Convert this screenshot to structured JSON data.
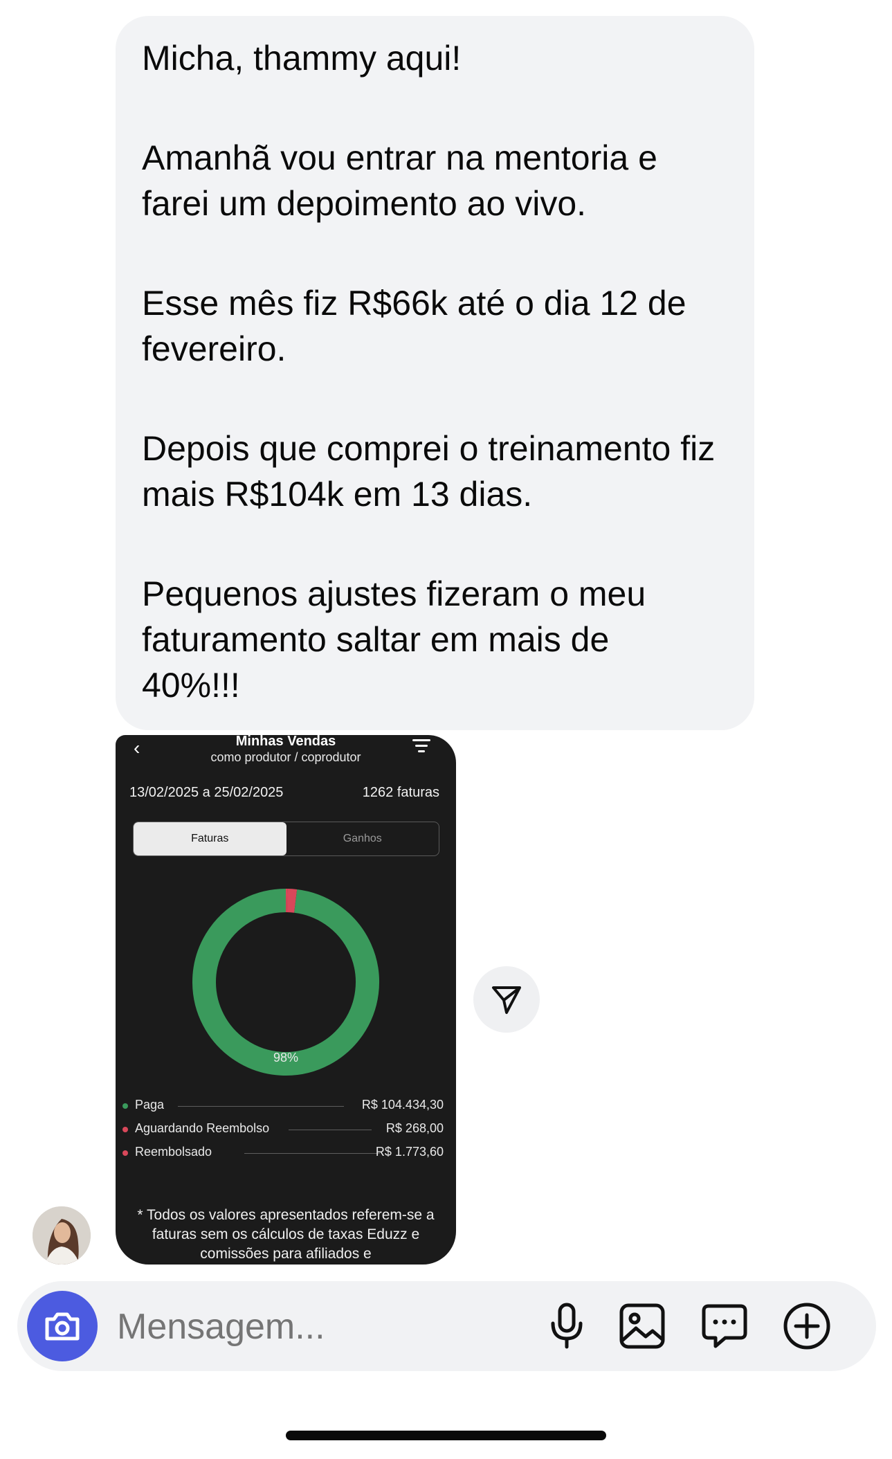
{
  "message": {
    "paragraphs": [
      "Micha, thammy aqui!",
      "Amanhã vou entrar na mentoria e farei um depoimento ao vivo.",
      "Esse mês fiz R$66k até o dia 12 de fevereiro.",
      "Depois que comprei o treinamento fiz mais R$104k em 13 dias.",
      "Pequenos ajustes fizeram o meu faturamento saltar em mais de 40%!!!"
    ]
  },
  "screenshot": {
    "title": "Minhas Vendas",
    "subtitle": "como produtor / coprodutor",
    "date_range": "13/02/2025 a 25/02/2025",
    "invoice_count": "1262 faturas",
    "tabs": [
      "Faturas",
      "Ganhos"
    ],
    "active_tab": "Faturas",
    "paid_percent_label": "98%",
    "legend": [
      {
        "label": "Paga",
        "value": "R$ 104.434,30",
        "color": "#3a9a5c"
      },
      {
        "label": "Aguardando Reembolso",
        "value": "R$ 268,00",
        "color": "#d9485a"
      },
      {
        "label": "Reembolsado",
        "value": "R$ 1.773,60",
        "color": "#d9485a"
      }
    ],
    "footnote": "* Todos os valores apresentados referem-se a faturas sem os cálculos de taxas Eduzz e comissões para afiliados e"
  },
  "chart_data": {
    "type": "pie",
    "categories": [
      "Paga",
      "Aguardando Reembolso",
      "Reembolsado"
    ],
    "values": [
      104434.3,
      268.0,
      1773.6
    ],
    "colors": [
      "#3a9a5c",
      "#d9485a",
      "#d9485a"
    ]
  },
  "input": {
    "placeholder": "Mensagem..."
  },
  "icons": {
    "camera": "camera-icon",
    "mic": "microphone-icon",
    "gallery": "image-icon",
    "sticker": "chat-bubble-icon",
    "add": "plus-circle-icon",
    "share": "send-icon"
  }
}
